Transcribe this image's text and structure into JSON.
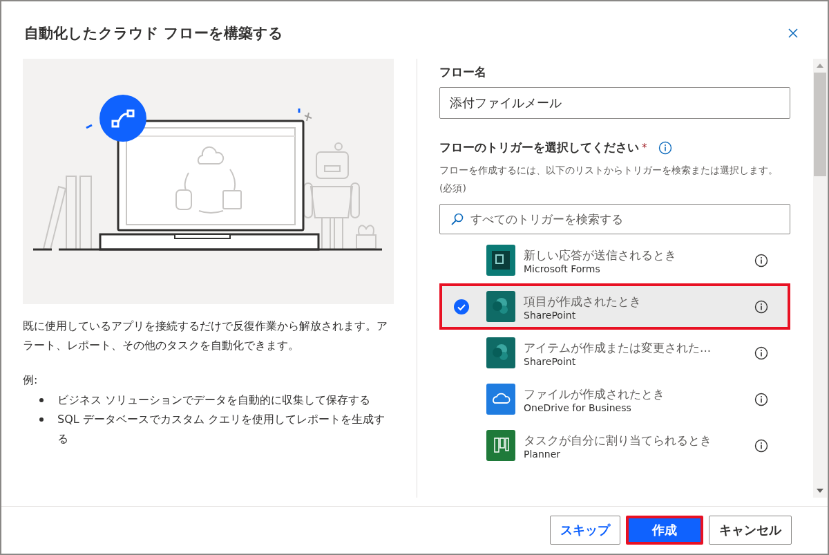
{
  "dialog": {
    "title": "自動化したクラウド フローを構築する"
  },
  "description": "既に使用しているアプリを接続するだけで反復作業から解放されます。アラート、レポート、その他のタスクを自動化できます。",
  "examples": {
    "label": "例:",
    "items": [
      "ビジネス ソリューションでデータを自動的に収集して保存する",
      "SQL データベースでカスタム クエリを使用してレポートを生成する"
    ]
  },
  "flow_name": {
    "label": "フロー名",
    "value": "添付ファイルメール"
  },
  "trigger": {
    "label": "フローのトリガーを選択してください",
    "required_mark": "*",
    "hint": "フローを作成するには、以下のリストからトリガーを検索または選択します。(必須)",
    "search_placeholder": "すべてのトリガーを検索する"
  },
  "triggers": [
    {
      "name": "新しい応答が送信されるとき",
      "app": "Microsoft Forms",
      "kind": "forms",
      "selected": false,
      "highlighted": false
    },
    {
      "name": "項目が作成されたとき",
      "app": "SharePoint",
      "kind": "sharepoint",
      "selected": true,
      "highlighted": true
    },
    {
      "name": "アイテムが作成または変更された...",
      "app": "SharePoint",
      "kind": "sharepoint",
      "selected": false,
      "highlighted": false
    },
    {
      "name": "ファイルが作成されたとき",
      "app": "OneDrive for Business",
      "kind": "onedrive",
      "selected": false,
      "highlighted": false
    },
    {
      "name": "タスクが自分に割り当てられるとき",
      "app": "Planner",
      "kind": "planner",
      "selected": false,
      "highlighted": false
    }
  ],
  "buttons": [
    {
      "label": "スキップ",
      "kind": "link",
      "highlighted": false
    },
    {
      "label": "作成",
      "kind": "primary",
      "highlighted": true
    },
    {
      "label": "キャンセル",
      "kind": "default",
      "highlighted": false
    }
  ]
}
